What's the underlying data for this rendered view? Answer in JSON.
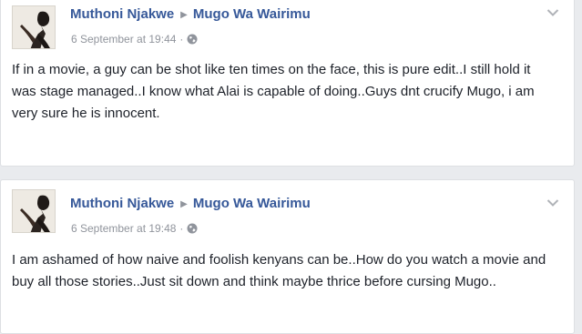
{
  "posts": [
    {
      "author": "Muthoni Njakwe",
      "recipient": "Mugo Wa Wairimu",
      "timestamp": "6 September at 19:44",
      "audience_icon": "globe-icon",
      "text": "If in a movie, a guy can be shot like ten times on the face, this is pure edit..I still hold it was stage managed..I know what Alai is capable of doing..Guys dnt crucify Mugo, i am very sure he is innocent."
    },
    {
      "author": "Muthoni Njakwe",
      "recipient": "Mugo Wa Wairimu",
      "timestamp": "6 September at 19:48",
      "audience_icon": "globe-icon",
      "text": "I am ashamed of how naive and foolish kenyans can be..How do you watch a movie and buy all those stories..Just sit down and think maybe thrice before cursing Mugo.."
    }
  ],
  "colors": {
    "page_background": "#e9ebee",
    "name_link": "#365899",
    "meta_text": "#90949c",
    "body_text": "#1d2129"
  }
}
